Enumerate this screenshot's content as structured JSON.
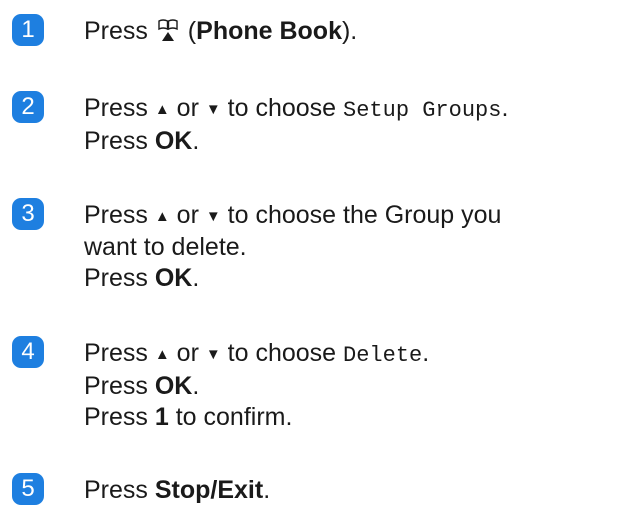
{
  "steps": [
    {
      "number": "1",
      "lines": [
        {
          "pre": "Press ",
          "icon": "phone-book-icon",
          "mid": " (",
          "bold": "Phone Book",
          "post": ")."
        }
      ]
    },
    {
      "number": "2",
      "lines": [
        {
          "pre": "Press ",
          "up": "▲",
          "or": " or ",
          "down": "▼",
          "to": " to choose ",
          "mono": "Setup Groups",
          "post": "."
        },
        {
          "pre": "Press ",
          "bold": "OK",
          "post": "."
        }
      ]
    },
    {
      "number": "3",
      "lines": [
        {
          "pre": "Press ",
          "up": "▲",
          "or": " or ",
          "down": "▼",
          "to": " to choose the Group you"
        },
        {
          "text": "want to delete."
        },
        {
          "pre": "Press ",
          "bold": "OK",
          "post": "."
        }
      ]
    },
    {
      "number": "4",
      "lines": [
        {
          "pre": "Press ",
          "up": "▲",
          "or": " or ",
          "down": "▼",
          "to": " to choose ",
          "mono": "Delete",
          "post": "."
        },
        {
          "pre": "Press ",
          "bold": "OK",
          "post": "."
        },
        {
          "pre": "Press ",
          "bold": "1",
          "post": " to confirm."
        }
      ]
    },
    {
      "number": "5",
      "lines": [
        {
          "pre": "Press ",
          "bold": "Stop/Exit",
          "post": "."
        }
      ]
    }
  ],
  "colors": {
    "badge": "#1e7fe0",
    "text": "#1a1a1a"
  }
}
